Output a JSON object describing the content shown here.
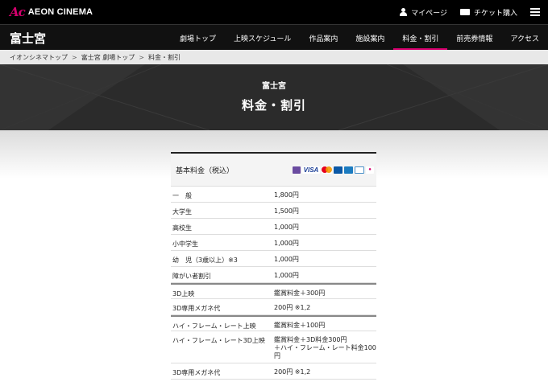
{
  "header": {
    "logo_mark": "Ac",
    "logo_text": "AEON CINEMA",
    "my_page": "マイページ",
    "ticket": "チケット購入"
  },
  "navbar": {
    "site_title": "富士宮",
    "items": [
      {
        "label": "劇場トップ"
      },
      {
        "label": "上映スケジュール"
      },
      {
        "label": "作品案内"
      },
      {
        "label": "施設案内"
      },
      {
        "label": "料金・割引",
        "active": true
      },
      {
        "label": "前売券情報"
      },
      {
        "label": "アクセス"
      }
    ]
  },
  "breadcrumb": [
    "イオンシネマトップ",
    "富士宮 劇場トップ",
    "料金・割引"
  ],
  "hero": {
    "subtitle": "富士宮",
    "title": "料金・割引"
  },
  "pricing": {
    "header_label": "基本料金（税込）",
    "card_logos": [
      "waon-icon",
      "visa-icon",
      "mastercard-icon",
      "jcb-icon",
      "amex-icon",
      "diners-icon",
      "jcb-premo-icon"
    ],
    "visa_text": "VISA",
    "rows": [
      {
        "label": "一　般",
        "value": "1,800円"
      },
      {
        "label": "大学生",
        "value": "1,500円"
      },
      {
        "label": "高校生",
        "value": "1,000円"
      },
      {
        "label": "小中学生",
        "value": "1,000円"
      },
      {
        "label": "幼　児（3歳以上）※3",
        "value": "1,000円"
      },
      {
        "label": "障がい者割引",
        "value": "1,000円"
      },
      {
        "label": "3D上映",
        "value": "鑑賞料金＋300円"
      },
      {
        "label": "3D専用メガネ代",
        "value": "200円 ※1,2"
      },
      {
        "label": "ハイ・フレーム・レート上映",
        "value": "鑑賞料金＋100円"
      },
      {
        "label": "ハイ・フレーム・レート3D上映",
        "value": "鑑賞料金＋3D料金300円\n＋ハイ・フレーム・レート料金100円"
      },
      {
        "label": "3D専用メガネ代",
        "value": "200円 ※1,2"
      }
    ]
  }
}
